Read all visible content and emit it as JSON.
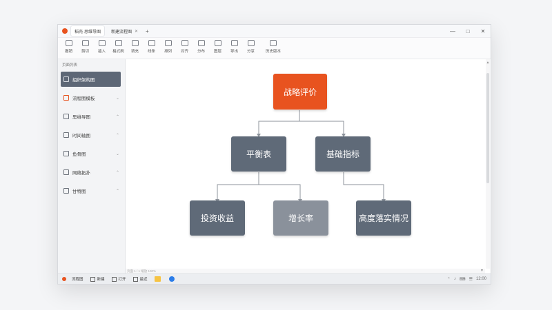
{
  "titlebar": {
    "tabs": [
      {
        "label": "稻壳·思维导图",
        "active": true
      },
      {
        "label": "新建流程图",
        "active": false
      }
    ],
    "new_tab": "+",
    "controls": [
      "—",
      "□",
      "✕"
    ]
  },
  "ribbon": {
    "tools": [
      {
        "label": "撤销",
        "icon": "undo-icon"
      },
      {
        "label": "剪切",
        "icon": "scissors-icon"
      },
      {
        "label": "插入",
        "icon": "insert-icon"
      },
      {
        "label": "格式刷",
        "icon": "brush-icon"
      },
      {
        "label": "填充",
        "icon": "fill-icon"
      },
      {
        "label": "线条",
        "icon": "line-icon"
      },
      {
        "label": "排列",
        "icon": "arrange-icon"
      },
      {
        "label": "对齐",
        "icon": "align-icon"
      },
      {
        "label": "分布",
        "icon": "distribute-icon"
      },
      {
        "label": "图层",
        "icon": "layer-icon"
      },
      {
        "label": "导出",
        "icon": "export-icon"
      },
      {
        "label": "分享",
        "icon": "share-icon"
      },
      {
        "label": "历史版本",
        "icon": "history-icon"
      }
    ]
  },
  "sidebar": {
    "header": "页面列表",
    "items": [
      {
        "label": "组织架构图",
        "selected": true
      },
      {
        "label": "流程图模板",
        "selected": false,
        "hot": true
      },
      {
        "label": "思维导图",
        "selected": false
      },
      {
        "label": "时间轴图",
        "selected": false
      },
      {
        "label": "鱼骨图",
        "selected": false
      },
      {
        "label": "网络拓扑",
        "selected": false
      },
      {
        "label": "甘特图",
        "selected": false
      }
    ]
  },
  "diagram": {
    "root": {
      "label": "战略评价",
      "color": "#e8531f"
    },
    "level2": [
      {
        "label": "平衡表",
        "color": "#5f6a78"
      },
      {
        "label": "基础指标",
        "color": "#5f6a78"
      }
    ],
    "level3": [
      {
        "label": "投资收益",
        "color": "#5f6a78"
      },
      {
        "label": "增长率",
        "color": "#8a919b"
      },
      {
        "label": "高度落实情况",
        "color": "#5f6a78"
      }
    ]
  },
  "hbar": {
    "text": "页面 1 / 1  缩放 100%"
  },
  "taskbar": {
    "app_label": "流程图",
    "items": [
      "新建",
      "打开",
      "最近"
    ],
    "apps": [
      {
        "name": "wps-app",
        "color": "#f6c343"
      },
      {
        "name": "browser-app",
        "color": "#2b7de9"
      }
    ],
    "tray": [
      "⌃",
      "♪",
      "⌨",
      "☰",
      "12:00"
    ]
  }
}
